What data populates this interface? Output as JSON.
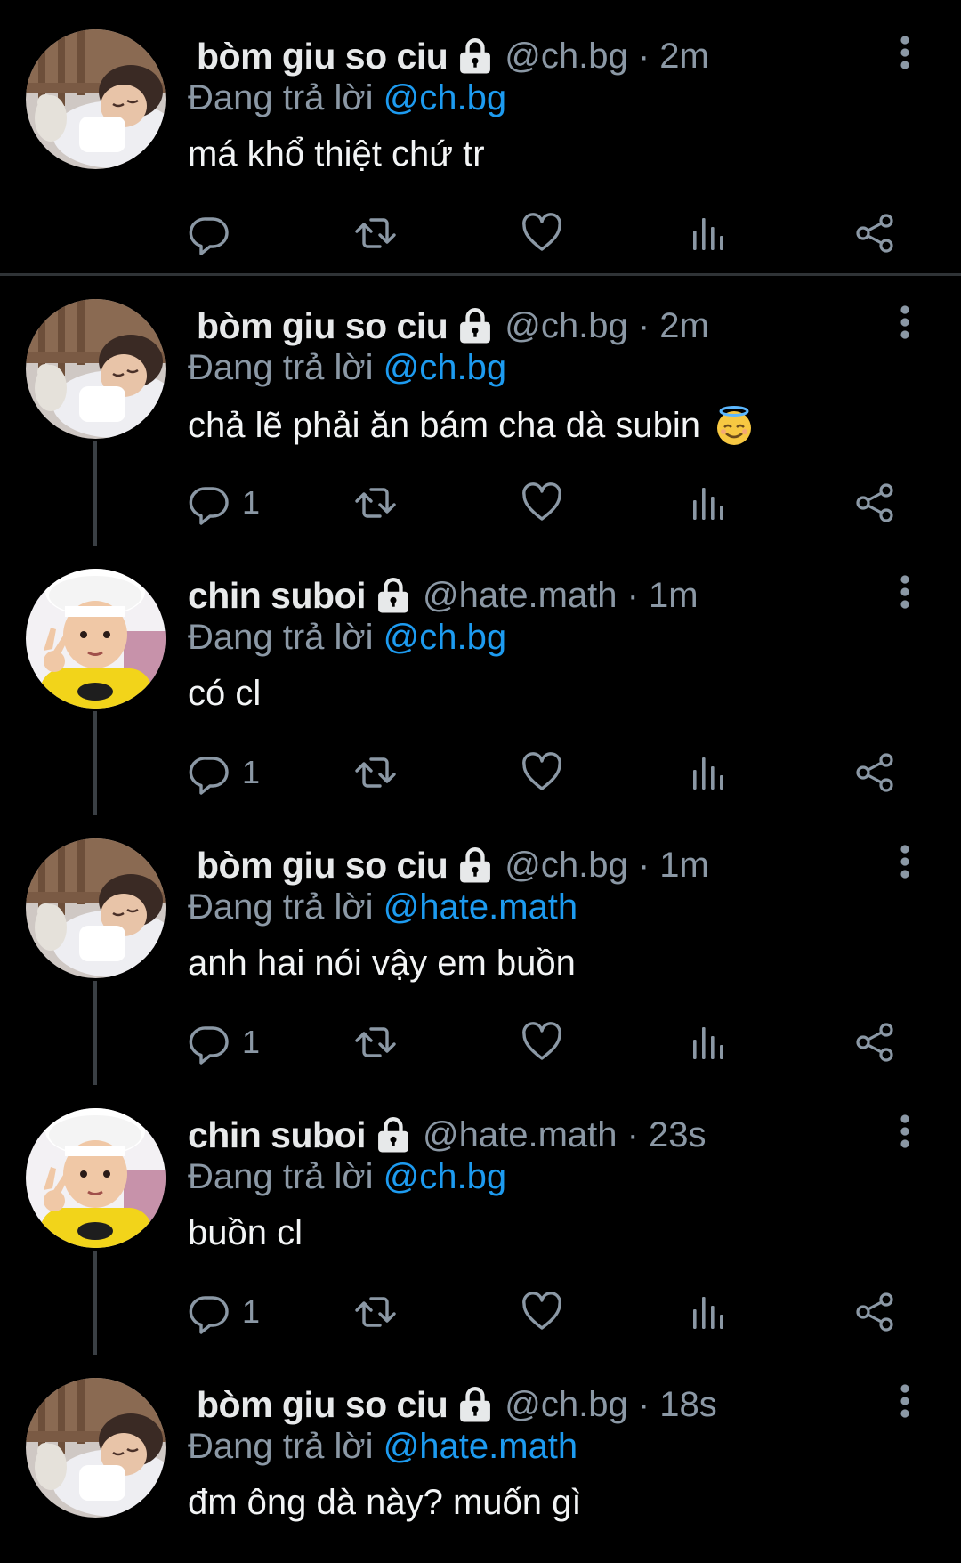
{
  "colors": {
    "background": "#000000",
    "text_primary": "#e7e9ea",
    "text_secondary": "#8b98a5",
    "accent": "#1d9bf0",
    "divider": "#2f3336"
  },
  "action_icons": [
    "reply-icon",
    "retweet-icon",
    "like-icon",
    "views-icon",
    "share-icon"
  ],
  "tweets": [
    {
      "display_name": "bòm giu so ciu",
      "handle_time": "@ch.bg · 2m",
      "reply_prefix": "Đang trả lời",
      "reply_target": "@ch.bg",
      "text": "má khổ thiệt chứ tr",
      "reply_count": "",
      "avatar": "sleeping-child-avatar"
    },
    {
      "display_name": "bòm giu so ciu",
      "handle_time": "@ch.bg · 2m",
      "reply_prefix": "Đang trả lời",
      "reply_target": "@ch.bg",
      "text": "chả lẽ phải ăn bám cha dà subin",
      "emoji": "smiling-face-with-halo",
      "reply_count": "1",
      "avatar": "sleeping-child-avatar"
    },
    {
      "display_name": "chin suboi",
      "handle_time": "@hate.math · 1m",
      "reply_prefix": "Đang trả lời",
      "reply_target": "@ch.bg",
      "text": "có cl",
      "reply_count": "1",
      "avatar": "chef-hat-child-avatar"
    },
    {
      "display_name": "bòm giu so ciu",
      "handle_time": "@ch.bg · 1m",
      "reply_prefix": "Đang trả lời",
      "reply_target": "@hate.math",
      "text": "anh hai nói vậy em buồn",
      "reply_count": "1",
      "avatar": "sleeping-child-avatar"
    },
    {
      "display_name": "chin suboi",
      "handle_time": "@hate.math · 23s",
      "reply_prefix": "Đang trả lời",
      "reply_target": "@ch.bg",
      "text": "buồn cl",
      "reply_count": "1",
      "avatar": "chef-hat-child-avatar"
    },
    {
      "display_name": "bòm giu so ciu",
      "handle_time": "@ch.bg · 18s",
      "reply_prefix": "Đang trả lời",
      "reply_target": "@hate.math",
      "text": "đm ông dà này? muốn gì",
      "avatar": "sleeping-child-avatar"
    }
  ]
}
